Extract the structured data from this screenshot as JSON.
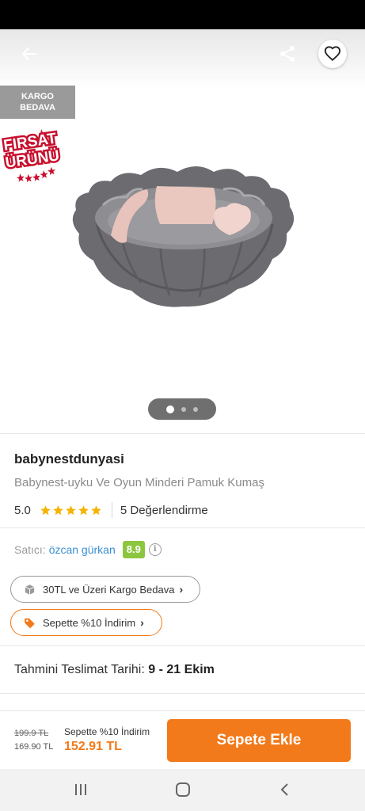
{
  "badges": {
    "cargo_line1": "KARGO",
    "cargo_line2": "BEDAVA",
    "firsat_line1": "FIRSAT",
    "firsat_line2": "ÜRÜNÜ"
  },
  "gallery": {
    "slide_count": 3,
    "active_slide": 1
  },
  "product": {
    "brand": "babynestdunyasi",
    "name": "Babynest-uyku Ve Oyun Minderi Pamuk Kumaş",
    "rating": "5.0",
    "stars": 5,
    "reviews": "5 Değerlendirme"
  },
  "seller": {
    "label": "Satıcı:",
    "name": "özcan gürkan",
    "score": "8.9"
  },
  "promos": {
    "cargo": "30TL ve Üzeri Kargo Bedava",
    "discount": "Sepette %10 İndirim"
  },
  "delivery": {
    "label": "Tahmini Teslimat Tarihi:",
    "dates": "9 - 21 Ekim"
  },
  "price": {
    "old": "199.9 TL",
    "current": "169.90 TL",
    "promo_label": "Sepette %10 İndirim",
    "promo_price": "152.91 TL"
  },
  "actions": {
    "add_to_cart": "Sepete Ekle"
  },
  "colors": {
    "accent": "#f27a1a",
    "seller_score": "#8cc63f",
    "link": "#3a8fd1",
    "star": "#f5b400"
  },
  "icons": [
    "back-arrow-icon",
    "share-icon",
    "heart-icon",
    "info-icon",
    "box-icon",
    "tag-icon",
    "chevron-right-icon",
    "recent-apps-icon",
    "home-icon",
    "back-icon"
  ]
}
